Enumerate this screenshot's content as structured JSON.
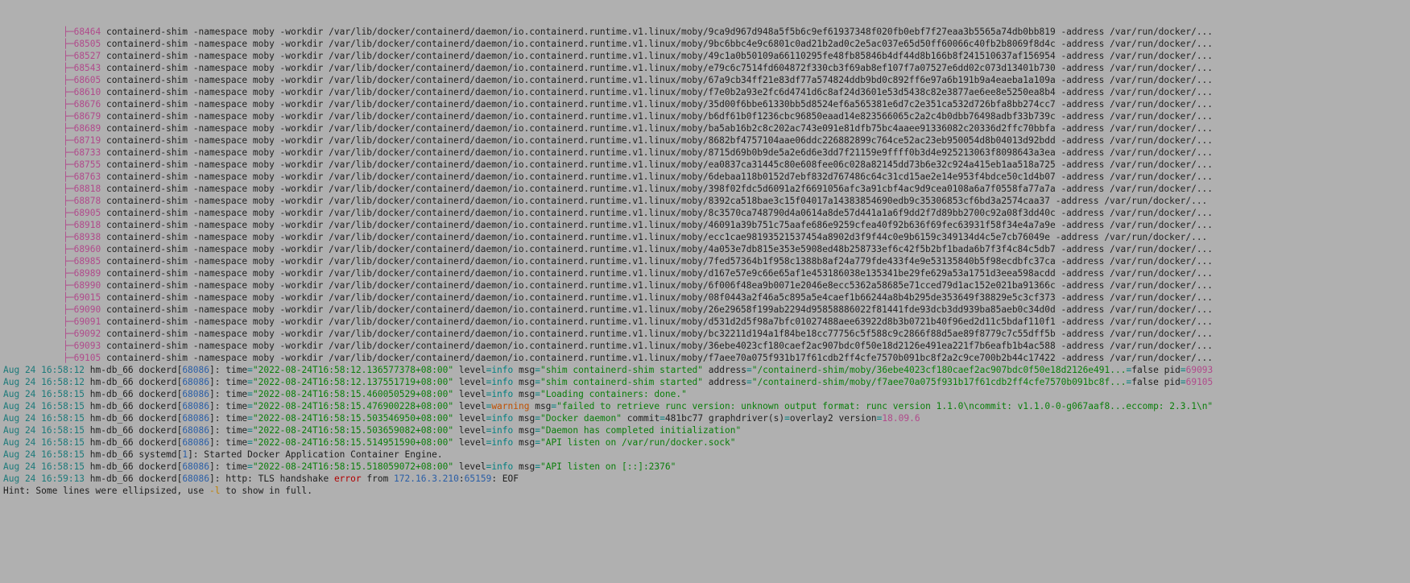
{
  "treeChar": "├─",
  "treePad": "           ",
  "shimPrefix": "containerd-shim -namespace moby -workdir /var/lib/docker/containerd/daemon/io.containerd.runtime.v1.linux/moby/",
  "shimSuffix": " -address /var/run/docker/...",
  "shimRows": [
    {
      "pid": "68464",
      "hash": "9ca9d967d948a5f5b6c9ef61937348f020fb0ebf7f27eaa3b5565a74db0bb819"
    },
    {
      "pid": "68505",
      "hash": "9bc6bbc4e9c6801c0ad21b2ad0c2e5ac037e65d50ff60066c40fb2b8069f8d4c"
    },
    {
      "pid": "68527",
      "hash": "49c1a0b50109a66110295fe48fb85846b4df44d8b166b8f241510637af156954"
    },
    {
      "pid": "68543",
      "hash": "e79c6c7514fd604872f330cb3f69ab8ef107f7a07527e6dd02c073d13401b730"
    },
    {
      "pid": "68605",
      "hash": "67a9cb34ff21e83df77a574824ddb9bd0c892ff6e97a6b191b9a4eaeba1a109a"
    },
    {
      "pid": "68610",
      "hash": "f7e0b2a93e2fc6d4741d6c8af24d3601e53d5438c82e3877ae6ee8e5250ea8b4"
    },
    {
      "pid": "68676",
      "hash": "35d00f6bbe61330bb5d8524ef6a565381e6d7c2e351ca532d726bfa8bb274cc7"
    },
    {
      "pid": "68679",
      "hash": "b6df61b0f1236cbc96850eaad14e823566065c2a2c4b0dbb76498adbf33b739c"
    },
    {
      "pid": "68689",
      "hash": "ba5ab16b2c8c202ac743e091e81dfb75bc4aaee91336082c20336d2ffc70bbfa"
    },
    {
      "pid": "68719",
      "hash": "8682bf4757104aae06ddc226882899c764ce52ac23eb950054d8b04013d92bdd"
    },
    {
      "pid": "68733",
      "hash": "8715d69b0b9de5a2e6d6e3dd7f21159e9ffff0b3d4e925213063f8098643a3ea"
    },
    {
      "pid": "68755",
      "hash": "ea0837ca31445c80e608fee06c028a82145dd73b6e32c924a415eb1aa518a725"
    },
    {
      "pid": "68763",
      "hash": "6debaa118b0152d7ebf832d767486c64c31cd15ae2e14e953f4bdce50c1d4b07"
    },
    {
      "pid": "68818",
      "hash": "398f02fdc5d6091a2f6691056afc3a91cbf4ac9d9cea0108a6a7f0558fa77a7a"
    },
    {
      "pid": "68878",
      "hash": "8392ca518bae3c15f04017a14383854690edb9c35306853cf6bd3a2574caa37"
    },
    {
      "pid": "68905",
      "hash": "8c3570ca748790d4a0614a8de57d441a1a6f9dd2f7d89bb2700c92a08f3dd40c"
    },
    {
      "pid": "68918",
      "hash": "46091a39b751c75aafe686e9259cfea40f92b636f69fec63931f58f34e4a7a9e"
    },
    {
      "pid": "68938",
      "hash": "ecc1cae98193521537454a8902d3f9f44c0e9b6159c349134d4c5e7cb76049e"
    },
    {
      "pid": "68960",
      "hash": "4a053e7db815e353e5908ed48b258733ef6c42f5b2bf1bada6b7f3f4c84c5db7"
    },
    {
      "pid": "68985",
      "hash": "7fed57364b1f958c1388b8af24a779fde433f4e9e53135840b5f98ecdbfc37ca"
    },
    {
      "pid": "68989",
      "hash": "d167e57e9c66e65af1e453186038e135341be29fe629a53a1751d3eea598acdd"
    },
    {
      "pid": "68990",
      "hash": "6f006f48ea9b0071e2046e8ecc5362a58685e71cced79d1ac152e021ba91366c"
    },
    {
      "pid": "69015",
      "hash": "08f0443a2f46a5c895a5e4caef1b66244a8b4b295de353649f38829e5c3cf373"
    },
    {
      "pid": "69090",
      "hash": "26e29658f199ab2294d95858886022f81441fde93dcb3dd939ba85aeb0c34d0d"
    },
    {
      "pid": "69091",
      "hash": "d531d2d5f98a7bfc01027488aee63922d8b3b0721b40f96ed2d11c5bdaf110f1"
    },
    {
      "pid": "69092",
      "hash": "bc32211d194a1f84be18cc77756c5f588c9c2866f88d5ae89f8779c7c55dff5b"
    },
    {
      "pid": "69093",
      "hash": "36ebe4023cf180caef2ac907bdc0f50e18d2126e491ea221f7b6eafb1b4ac588"
    },
    {
      "pid": "69105",
      "hash": "f7aee70a075f931b17f61cdb2ff4cfe7570b091bc8f2a2c9ce700b2b44c17422"
    }
  ],
  "blank": "",
  "logBracketPid": "68086",
  "systemdPid": "1",
  "logs": [
    {
      "date": "Aug 24",
      "clock": "16:58:12",
      "host": "hm-db_66",
      "proc": "dockerd",
      "time": "\"2022-08-24T16:58:12.136577378+08:00\"",
      "level": "info",
      "msg": "\"shim containerd-shim started\"",
      "tail": [
        [
          "key",
          "address"
        ],
        [
          "eq",
          "="
        ],
        [
          "str",
          "\"/containerd-shim/moby/36ebe4023cf180caef2ac907bdc0f50e18d2126e491..."
        ],
        [
          "eq",
          "="
        ],
        [
          "plain",
          "false "
        ],
        [
          "key",
          "pid"
        ],
        [
          "eq",
          "="
        ],
        [
          "pid",
          "69093"
        ]
      ]
    },
    {
      "date": "Aug 24",
      "clock": "16:58:12",
      "host": "hm-db_66",
      "proc": "dockerd",
      "time": "\"2022-08-24T16:58:12.137551719+08:00\"",
      "level": "info",
      "msg": "\"shim containerd-shim started\"",
      "tail": [
        [
          "key",
          "address"
        ],
        [
          "eq",
          "="
        ],
        [
          "str",
          "\"/containerd-shim/moby/f7aee70a075f931b17f61cdb2ff4cfe7570b091bc8f..."
        ],
        [
          "eq",
          "="
        ],
        [
          "plain",
          "false "
        ],
        [
          "key",
          "pid"
        ],
        [
          "eq",
          "="
        ],
        [
          "pid",
          "69105"
        ]
      ]
    },
    {
      "date": "Aug 24",
      "clock": "16:58:15",
      "host": "hm-db_66",
      "proc": "dockerd",
      "time": "\"2022-08-24T16:58:15.460050529+08:00\"",
      "level": "info",
      "msg": "\"Loading containers: done.\"",
      "tail": []
    },
    {
      "date": "Aug 24",
      "clock": "16:58:15",
      "host": "hm-db_66",
      "proc": "dockerd",
      "time": "\"2022-08-24T16:58:15.476900228+08:00\"",
      "level": "warning",
      "msg": "\"failed to retrieve runc version: unknown output format: runc version 1.1.0\\ncommit: v1.1.0-0-g067aaf8...eccomp: 2.3.1\\n\"",
      "tail": []
    },
    {
      "date": "Aug 24",
      "clock": "16:58:15",
      "host": "hm-db_66",
      "proc": "dockerd",
      "time": "\"2022-08-24T16:58:15.503546950+08:00\"",
      "level": "info",
      "msg": "\"Docker daemon\"",
      "tail": [
        [
          "key",
          "commit"
        ],
        [
          "eq",
          "="
        ],
        [
          "plain",
          "481bc77 "
        ],
        [
          "key",
          "graphdriver(s)"
        ],
        [
          "eq",
          "="
        ],
        [
          "plain",
          "overlay2 "
        ],
        [
          "key",
          "version"
        ],
        [
          "eq",
          "="
        ],
        [
          "pid",
          "18.09.6"
        ]
      ]
    },
    {
      "date": "Aug 24",
      "clock": "16:58:15",
      "host": "hm-db_66",
      "proc": "dockerd",
      "time": "\"2022-08-24T16:58:15.503659082+08:00\"",
      "level": "info",
      "msg": "\"Daemon has completed initialization\"",
      "tail": []
    },
    {
      "date": "Aug 24",
      "clock": "16:58:15",
      "host": "hm-db_66",
      "proc": "dockerd",
      "time": "\"2022-08-24T16:58:15.514951590+08:00\"",
      "level": "info",
      "msg": "\"API listen on /var/run/docker.sock\"",
      "tail": []
    }
  ],
  "systemdLine": {
    "date": "Aug 24",
    "clock": "16:58:15",
    "host": "hm-db_66",
    "proc": "systemd",
    "text": "Started Docker Application Container Engine."
  },
  "apiListen2": {
    "date": "Aug 24",
    "clock": "16:58:15",
    "host": "hm-db_66",
    "proc": "dockerd",
    "time": "\"2022-08-24T16:58:15.518059072+08:00\"",
    "level": "info",
    "msg": "\"API listen on [::]:2376\""
  },
  "tlsLine": {
    "date": "Aug 24",
    "clock": "16:59:13",
    "host": "hm-db_66",
    "proc": "dockerd",
    "prefix": "http: TLS handshake",
    "errWord": "error",
    "mid": "from",
    "ip": "172.16.3.210",
    "port": "65159",
    "suffix": "EOF"
  },
  "hint": {
    "pre": "Hint: Some lines were ellipsized, use ",
    "flag": "-l",
    "post": " to show in full."
  }
}
